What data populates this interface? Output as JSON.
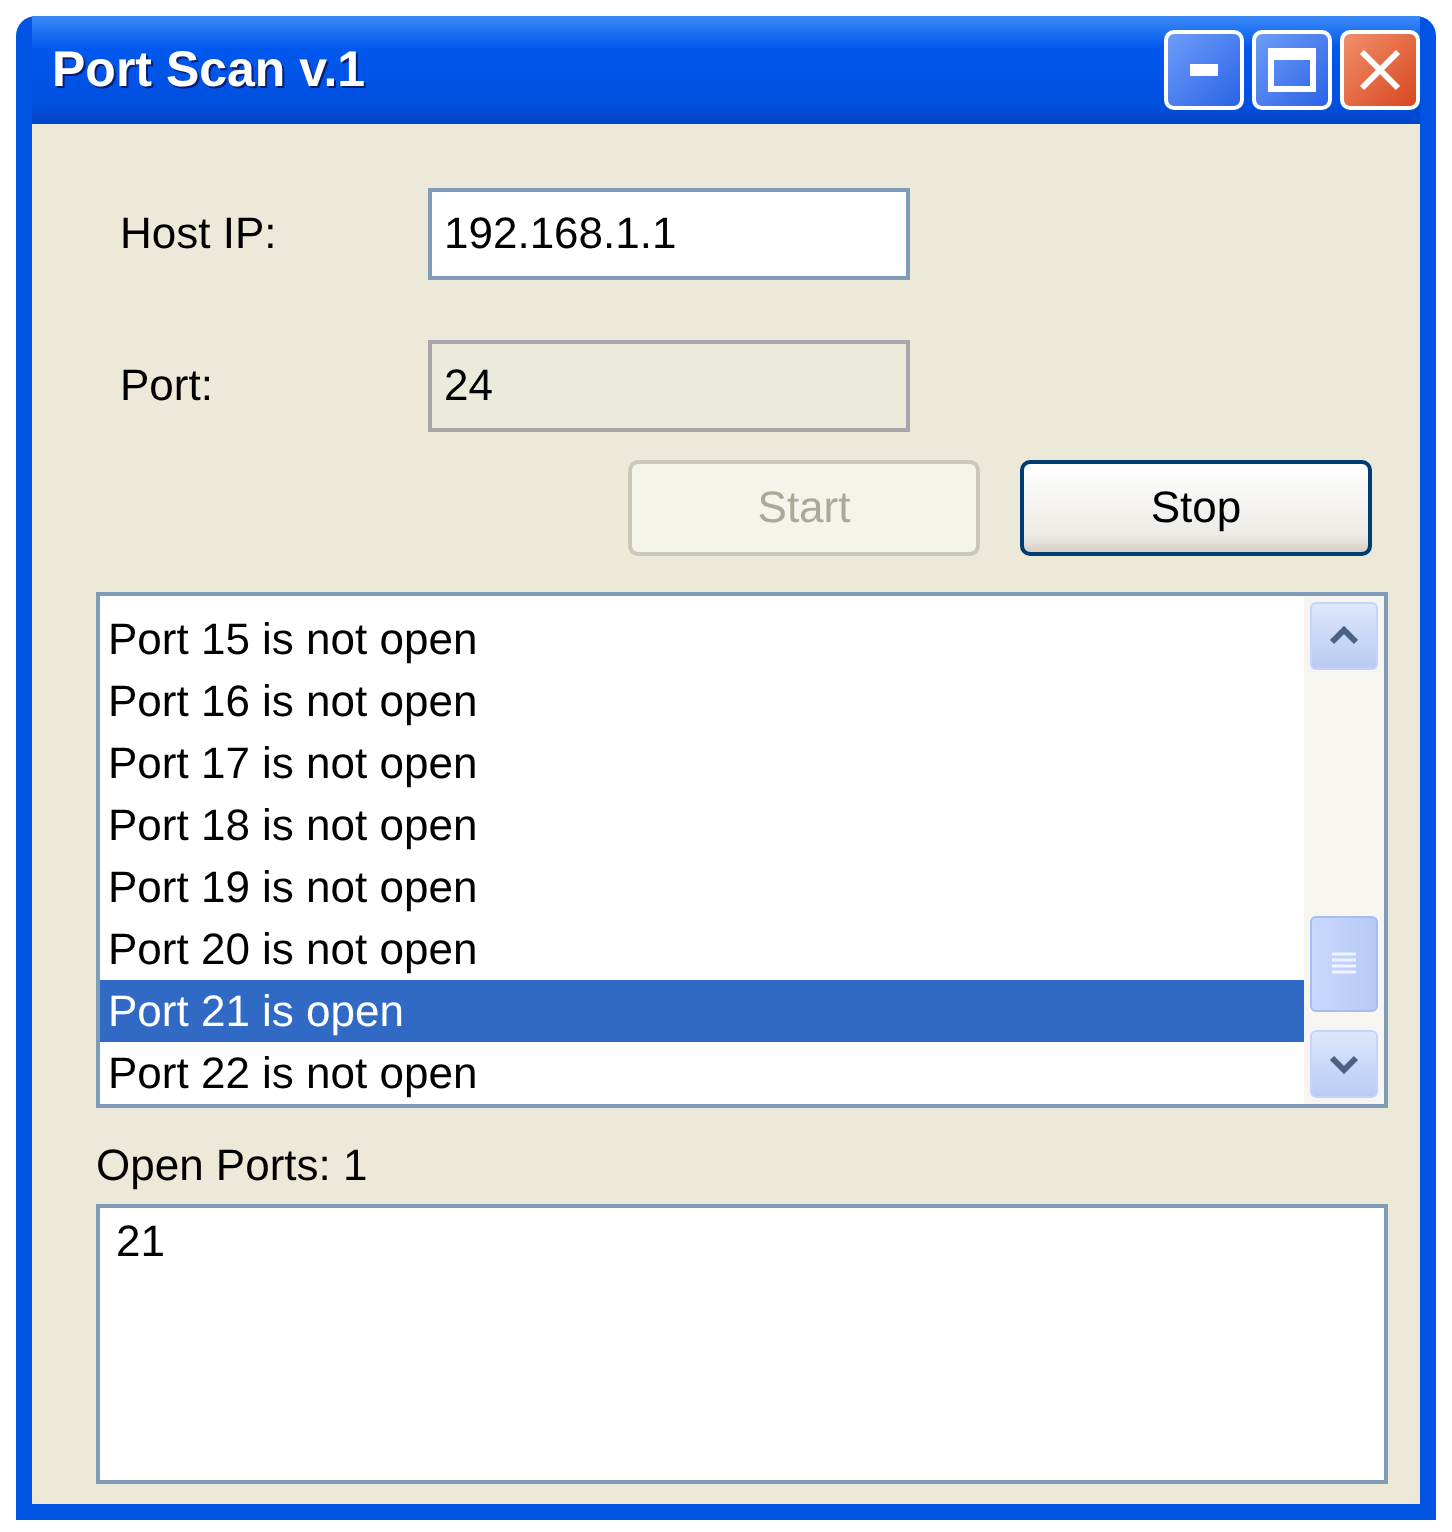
{
  "window": {
    "title": "Port Scan v.1"
  },
  "form": {
    "host_label": "Host IP:",
    "host_value": "192.168.1.1",
    "port_label": "Port:",
    "port_value": "24",
    "port_disabled": true
  },
  "buttons": [
    {
      "label": "Start",
      "disabled": true
    },
    {
      "label": "Stop",
      "disabled": false
    }
  ],
  "results": [
    {
      "text": "Port 15 is not open",
      "selected": false
    },
    {
      "text": "Port 16 is not open",
      "selected": false
    },
    {
      "text": "Port 17 is not open",
      "selected": false
    },
    {
      "text": "Port 18 is not open",
      "selected": false
    },
    {
      "text": "Port 19 is not open",
      "selected": false
    },
    {
      "text": "Port 20 is not open",
      "selected": false
    },
    {
      "text": "Port 21 is open",
      "selected": true
    },
    {
      "text": "Port 22 is not open",
      "selected": false
    }
  ],
  "open_ports": {
    "label": "Open Ports: 1",
    "lines": [
      "21"
    ]
  }
}
